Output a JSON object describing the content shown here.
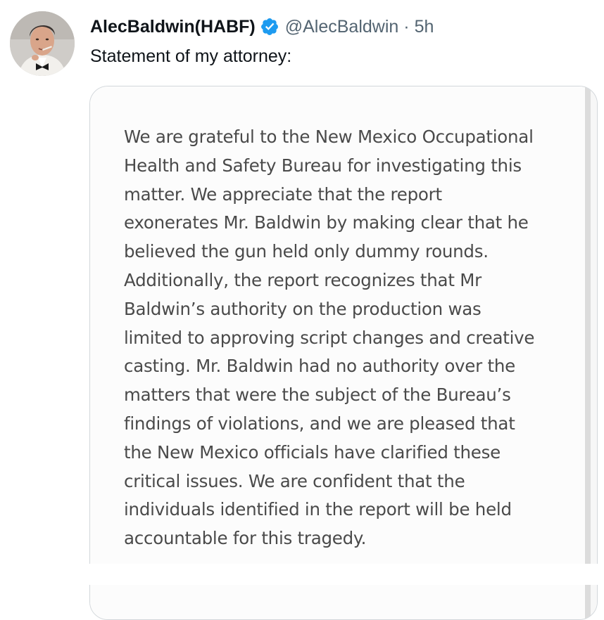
{
  "tweet": {
    "display_name": "AlecBaldwin(HABF)",
    "handle": "@AlecBaldwin",
    "separator": "·",
    "time": "5h",
    "text": "Statement of my attorney:",
    "verified_icon": "verified-badge-icon",
    "accent_color": "#1d9bf0"
  },
  "media": {
    "statement_lines": [
      "We are grateful to the New Mexico Occupational",
      "Health and Safety Bureau for investigating this",
      "matter.  We appreciate that the report",
      "exonerates Mr. Baldwin by making clear that he",
      "believed the gun held only dummy rounds.",
      "Additionally, the report recognizes that Mr",
      "Baldwin’s authority on the production was",
      "limited to approving script changes and creative",
      "casting.  Mr. Baldwin had no authority over the",
      "matters that were the subject of the Bureau’s",
      "findings of violations, and we are pleased that",
      "the New Mexico officials have clarified these",
      "critical issues.  We are confident that the",
      "individuals identified in the report will be held",
      "accountable for this tragedy."
    ]
  }
}
